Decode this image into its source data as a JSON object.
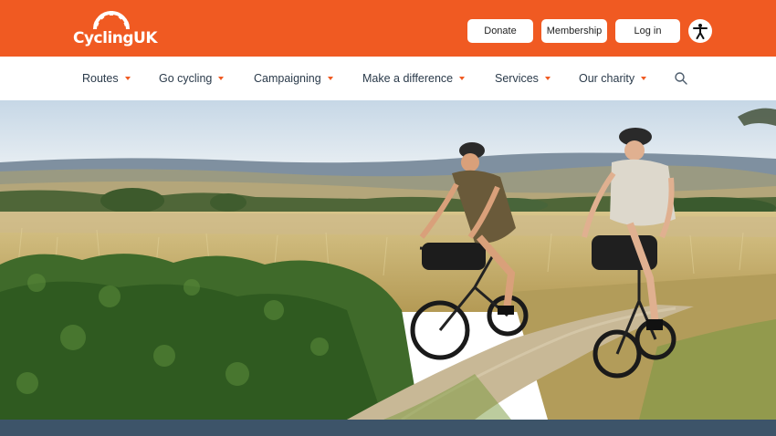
{
  "brand": {
    "logo_text": "CyclingUK"
  },
  "header": {
    "buttons": {
      "donate": "Donate",
      "membership": "Membership",
      "login": "Log in"
    },
    "accessibility_icon": "accessibility-icon"
  },
  "nav": {
    "items": [
      {
        "label": "Routes"
      },
      {
        "label": "Go cycling"
      },
      {
        "label": "Campaigning"
      },
      {
        "label": "Make a difference"
      },
      {
        "label": "Services"
      },
      {
        "label": "Our charity"
      }
    ],
    "search_icon": "search-icon"
  },
  "colors": {
    "brand_orange": "#f05a22",
    "nav_text": "#2a3a4a",
    "footer_band": "#3d5469"
  },
  "hero": {
    "image": "cyclists-riding-gravel-path-through-countryside"
  }
}
